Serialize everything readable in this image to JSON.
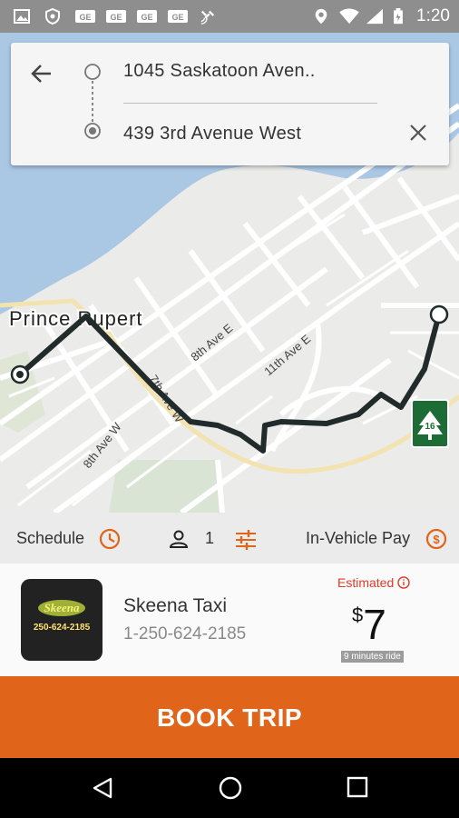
{
  "status_bar": {
    "time": "1:20"
  },
  "route": {
    "origin": "1045 Saskatoon Aven..",
    "destination": "439 3rd Avenue West"
  },
  "map": {
    "city_label": "Prince Rupert",
    "street_labels": [
      "8th Ave E",
      "11th Ave E",
      "8th Ave W",
      "7th Ave W"
    ],
    "highway_shield": "16"
  },
  "options": {
    "schedule_label": "Schedule",
    "passenger_count": "1",
    "payment_label": "In-Vehicle Pay",
    "payment_symbol": "$"
  },
  "taxi": {
    "name": "Skeena Taxi",
    "phone": "1-250-624-2185",
    "logo_text": "Skeena",
    "logo_phone": "250-624-2185",
    "estimated_label": "Estimated",
    "currency": "$",
    "price": "7",
    "duration": "9 minutes ride"
  },
  "book_button_label": "BOOK TRIP",
  "colors": {
    "accent": "#e0651a",
    "estimate": "#e03a2a",
    "map_water": "#aac8e4"
  }
}
